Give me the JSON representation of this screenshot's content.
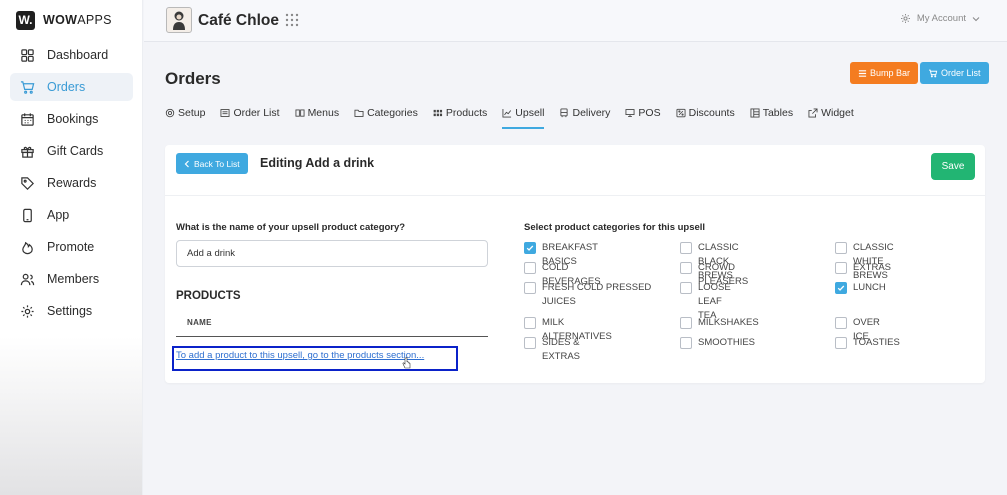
{
  "brand": {
    "logo_mark": "W.",
    "name_bold": "WOW",
    "name_rest": "APPS"
  },
  "sidebar": {
    "items": [
      {
        "label": "Dashboard",
        "icon": "dashboard-icon"
      },
      {
        "label": "Orders",
        "icon": "cart-icon",
        "active": true
      },
      {
        "label": "Bookings",
        "icon": "calendar-icon"
      },
      {
        "label": "Gift Cards",
        "icon": "gift-icon"
      },
      {
        "label": "Rewards",
        "icon": "tag-icon"
      },
      {
        "label": "App",
        "icon": "phone-icon"
      },
      {
        "label": "Promote",
        "icon": "flame-icon"
      },
      {
        "label": "Members",
        "icon": "members-icon"
      },
      {
        "label": "Settings",
        "icon": "gear-icon"
      }
    ]
  },
  "topbar": {
    "venue": "Café Chloe",
    "account": "My Account"
  },
  "header": {
    "title": "Orders",
    "bump_bar": "Bump Bar",
    "order_list": "Order List"
  },
  "tabs": [
    {
      "label": "Setup"
    },
    {
      "label": "Order List"
    },
    {
      "label": "Menus"
    },
    {
      "label": "Categories"
    },
    {
      "label": "Products"
    },
    {
      "label": "Upsell",
      "active": true
    },
    {
      "label": "Delivery"
    },
    {
      "label": "POS"
    },
    {
      "label": "Discounts"
    },
    {
      "label": "Tables"
    },
    {
      "label": "Widget"
    }
  ],
  "editor": {
    "back_label": "Back To List",
    "title": "Editing Add a drink",
    "save_label": "Save",
    "question": "What is the name of your upsell product category?",
    "name_value": "Add a drink",
    "products_heading": "PRODUCTS",
    "col_name": "NAME",
    "products_link": "To add a product to this upsell, go to the products section...",
    "categories_label": "Select product categories for this upsell"
  },
  "categories": [
    {
      "label": "BREAKFAST BASICS",
      "checked": true
    },
    {
      "label": "CLASSIC BLACK BREWS",
      "checked": false
    },
    {
      "label": "CLASSIC WHITE BREWS",
      "checked": false
    },
    {
      "label": "COLD BEVERAGES",
      "checked": false
    },
    {
      "label": "CROWD PLEASERS",
      "checked": false
    },
    {
      "label": "EXTRAS",
      "checked": false
    },
    {
      "label": "FRESH COLD PRESSED JUICES",
      "checked": false
    },
    {
      "label": "LOOSE LEAF TEA",
      "checked": false
    },
    {
      "label": "LUNCH",
      "checked": true
    },
    {
      "label": "MILK ALTERNATIVES",
      "checked": false
    },
    {
      "label": "MILKSHAKES",
      "checked": false
    },
    {
      "label": "OVER ICE",
      "checked": false
    },
    {
      "label": "SIDES & EXTRAS",
      "checked": false
    },
    {
      "label": "SMOOTHIES",
      "checked": false
    },
    {
      "label": "TOASTIES",
      "checked": false
    }
  ],
  "colors": {
    "accent": "#3fa9e0",
    "save": "#22b573",
    "bump_bar": "#f47c20",
    "highlight": "#0b22c9"
  }
}
